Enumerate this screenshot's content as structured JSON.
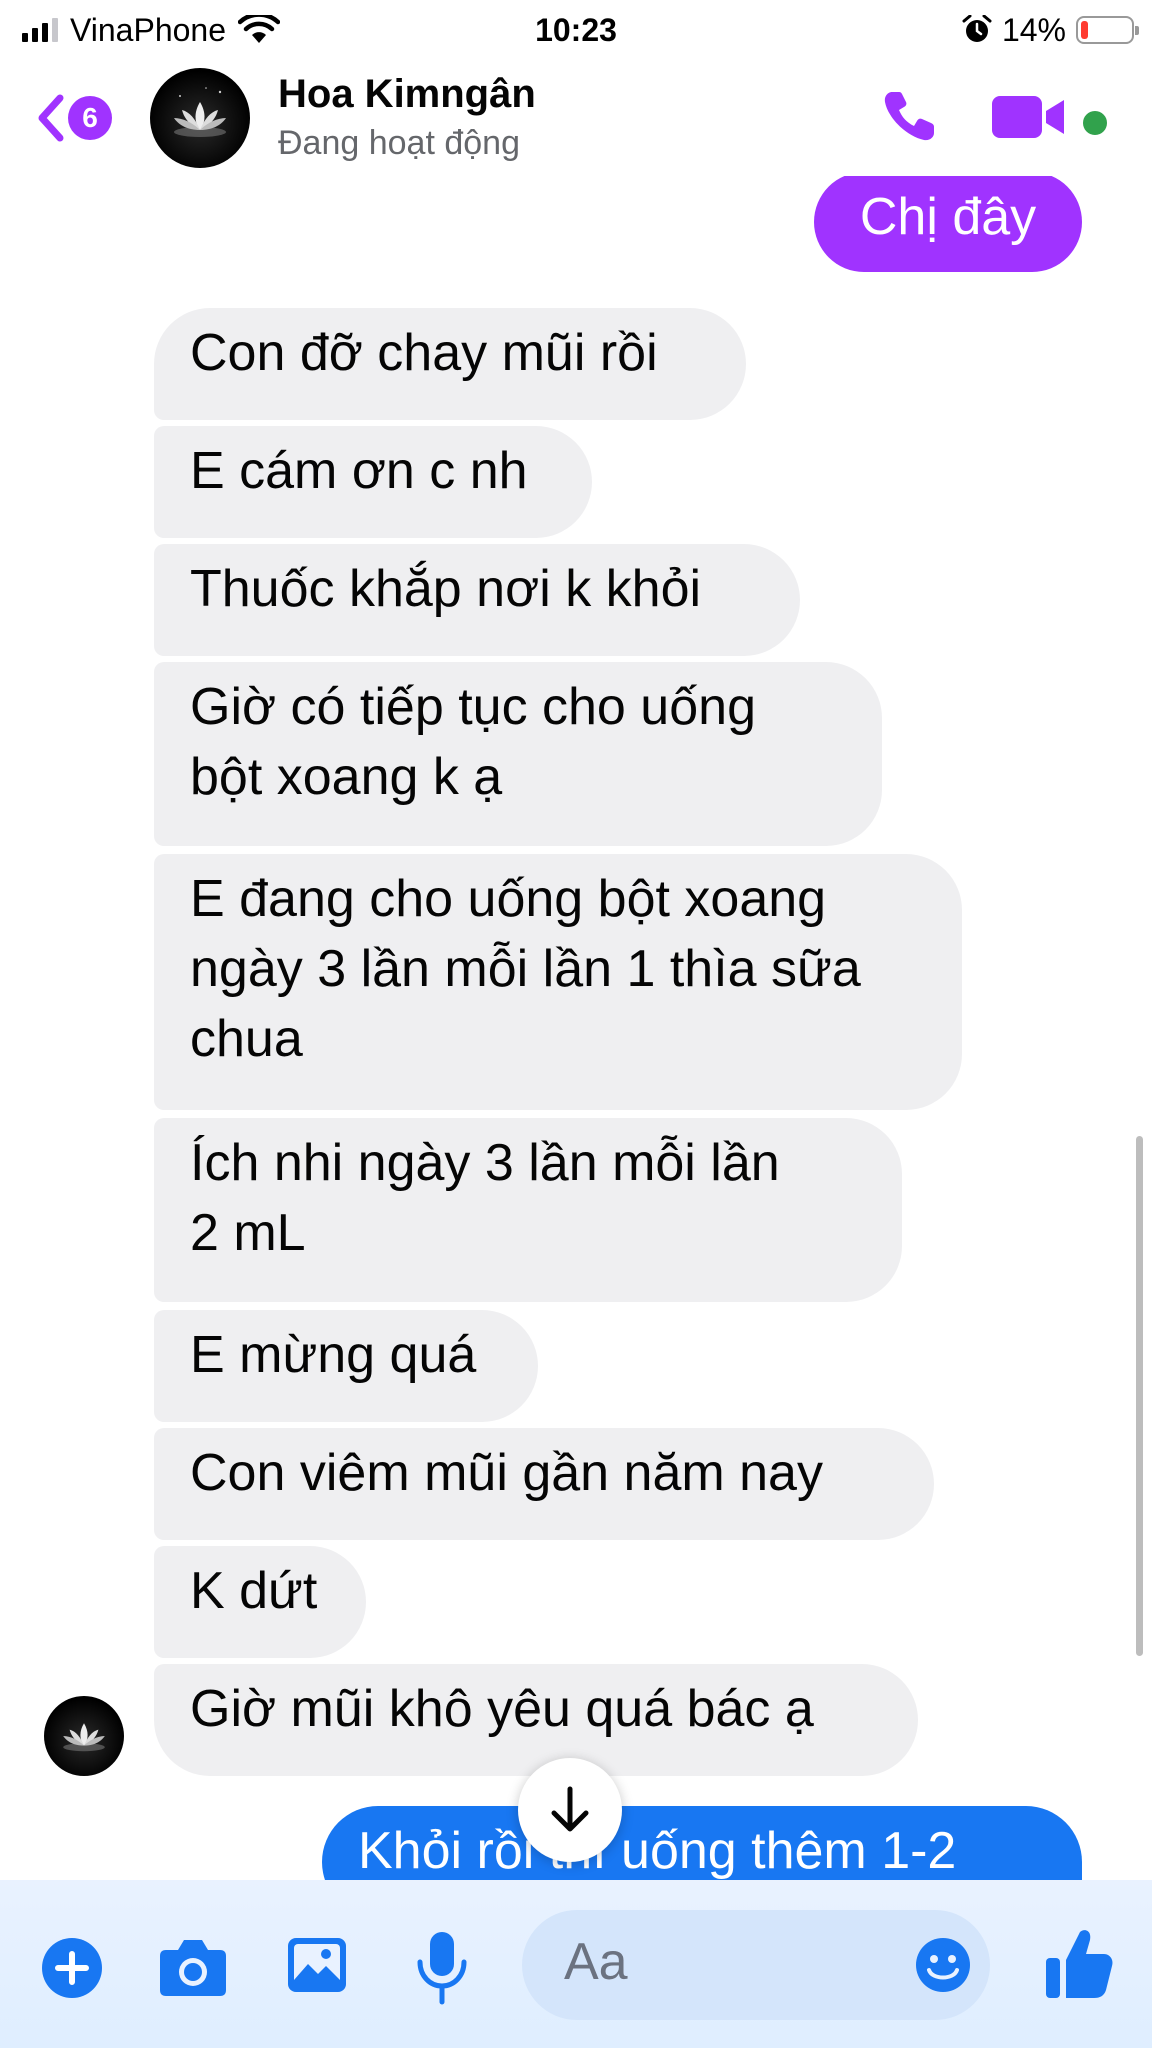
{
  "status_bar": {
    "carrier": "VinaPhone",
    "time": "10:23",
    "battery_pct": "14%",
    "battery_level": 0.14,
    "icons": [
      "signal-icon",
      "wifi-icon",
      "alarm-icon",
      "battery-icon"
    ]
  },
  "header": {
    "back_badge": "6",
    "contact_name": "Hoa Kimngân",
    "contact_status": "Đang hoạt động",
    "icons": [
      "back-chevron-icon",
      "phone-icon",
      "video-camera-icon"
    ],
    "colors": {
      "accent": "#a033ff",
      "online": "#31a24c"
    }
  },
  "messages": [
    {
      "dir": "out",
      "text": "Chị đây",
      "color": "#a033ff"
    },
    {
      "dir": "in",
      "text": "Con đỡ chay mũi rồi"
    },
    {
      "dir": "in",
      "text": "E cám ơn c nh"
    },
    {
      "dir": "in",
      "text": "Thuốc khắp nơi k khỏi"
    },
    {
      "dir": "in",
      "lines": [
        "Giờ có tiếp tục cho uống",
        "bột xoang k ạ"
      ]
    },
    {
      "dir": "in",
      "lines": [
        "E đang cho uống bột xoang",
        "ngày 3 lần mỗi lần 1 thìa sữa",
        "chua"
      ]
    },
    {
      "dir": "in",
      "lines": [
        "Ích nhi ngày 3 lần mỗi lần",
        "2 mL"
      ]
    },
    {
      "dir": "in",
      "text": "E mừng quá"
    },
    {
      "dir": "in",
      "text": "Con viêm mũi gần năm nay"
    },
    {
      "dir": "in",
      "text": "K dứt"
    },
    {
      "dir": "in",
      "text": "Giờ mũi khô yêu quá bác ạ"
    },
    {
      "dir": "out",
      "text": "Khỏi rồi thì uống thêm 1-2",
      "color": "#1877f2"
    }
  ],
  "composer": {
    "placeholder": "Aa",
    "icons": [
      "plus-icon",
      "camera-icon",
      "image-icon",
      "microphone-icon",
      "emoji-icon",
      "thumbs-up-icon"
    ],
    "accent": "#1877f2"
  },
  "scroll_down_icon": "arrow-down-icon"
}
